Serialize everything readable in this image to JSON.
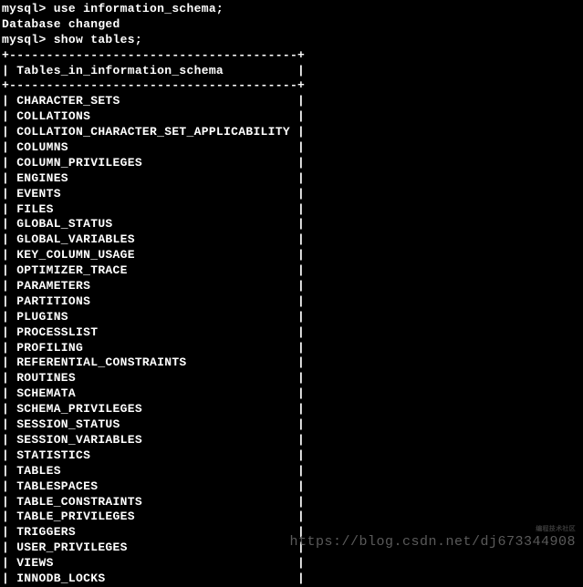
{
  "prompt1": "mysql> use information_schema;",
  "response1": "Database changed",
  "prompt2": "mysql> show tables;",
  "border": "+---------------------------------------+",
  "header_label": "Tables_in_information_schema",
  "tables": [
    "CHARACTER_SETS",
    "COLLATIONS",
    "COLLATION_CHARACTER_SET_APPLICABILITY",
    "COLUMNS",
    "COLUMN_PRIVILEGES",
    "ENGINES",
    "EVENTS",
    "FILES",
    "GLOBAL_STATUS",
    "GLOBAL_VARIABLES",
    "KEY_COLUMN_USAGE",
    "OPTIMIZER_TRACE",
    "PARAMETERS",
    "PARTITIONS",
    "PLUGINS",
    "PROCESSLIST",
    "PROFILING",
    "REFERENTIAL_CONSTRAINTS",
    "ROUTINES",
    "SCHEMATA",
    "SCHEMA_PRIVILEGES",
    "SESSION_STATUS",
    "SESSION_VARIABLES",
    "STATISTICS",
    "TABLES",
    "TABLESPACES",
    "TABLE_CONSTRAINTS",
    "TABLE_PRIVILEGES",
    "TRIGGERS",
    "USER_PRIVILEGES",
    "VIEWS",
    "INNODB_LOCKS"
  ],
  "watermark": "https://blog.csdn.net/dj673344908",
  "watermark_tiny": "编程技术社区"
}
